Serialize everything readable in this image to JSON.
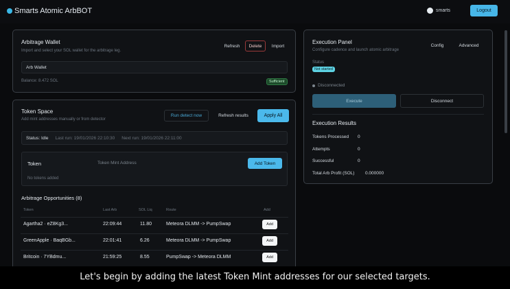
{
  "header": {
    "app_title": "Smarts Atomic ArbBOT",
    "username": "smarts",
    "logout_label": "Logout"
  },
  "wallet": {
    "title": "Arbitrage Wallet",
    "subtitle": "Import and select your SOL wallet for the arbitrage leg.",
    "refresh_label": "Refresh",
    "delete_label": "Delete",
    "import_label": "Import",
    "selected_wallet": "Arb Wallet",
    "balance": "Balance: 8.472 SOL",
    "status_badge": "Sufficient"
  },
  "token_space": {
    "title": "Token Space",
    "subtitle": "Add mint addresses manually or from detector",
    "run_detect_label": "Run detect now",
    "refresh_results_label": "Refresh results",
    "apply_all_label": "Apply All",
    "status": "Status: Idle",
    "last_run": "Last run: 19/01/2026 22:10:30",
    "next_run": "Next run: 19/01/2026 22:11:00",
    "token_label": "Token",
    "mint_placeholder": "Token Mint Address",
    "add_token_label": "Add Token",
    "empty_text": "No tokens added"
  },
  "opportunities": {
    "title": "Arbitrage Opportunities (8)",
    "columns": [
      "Token",
      "Last Arb",
      "SOL Liq",
      "Route",
      "Add"
    ],
    "rows": [
      {
        "token": "Agartha2 · eZ8Kg3...",
        "last_arb": "22:09:44",
        "sol_liq": "11.80",
        "route": "Meteora DLMM -> PumpSwap",
        "add": "Add"
      },
      {
        "token": "GreenApple · BaqBGb...",
        "last_arb": "22:01:41",
        "sol_liq": "6.26",
        "route": "Meteora DLMM -> PumpSwap",
        "add": "Add"
      },
      {
        "token": "Britcoin · 7YBdmu...",
        "last_arb": "21:59:25",
        "sol_liq": "8.55",
        "route": "PumpSwap -> Meteora DLMM",
        "add": "Add"
      }
    ]
  },
  "execution": {
    "title": "Execution Panel",
    "subtitle": "Configure cadence and launch atomic arbitrage",
    "config_label": "Config",
    "advanced_label": "Advanced",
    "status_label": "Status",
    "status_badge": "Not started",
    "connection": "Disconnected",
    "execute_label": "Execute",
    "disconnect_label": "Disconnect"
  },
  "results": {
    "title": "Execution Results",
    "rows": [
      {
        "label": "Tokens Processed",
        "value": "0"
      },
      {
        "label": "Attempts",
        "value": "0"
      },
      {
        "label": "Successful",
        "value": "0"
      },
      {
        "label": "Total Arb Profit (SOL)",
        "value": "0.000000"
      }
    ]
  },
  "caption": "Let's begin by adding the latest Token Mint addresses for our selected targets.",
  "colors": {
    "accent": "#47b6e8",
    "danger": "#9b3a3a",
    "success": "#2f7a44"
  }
}
